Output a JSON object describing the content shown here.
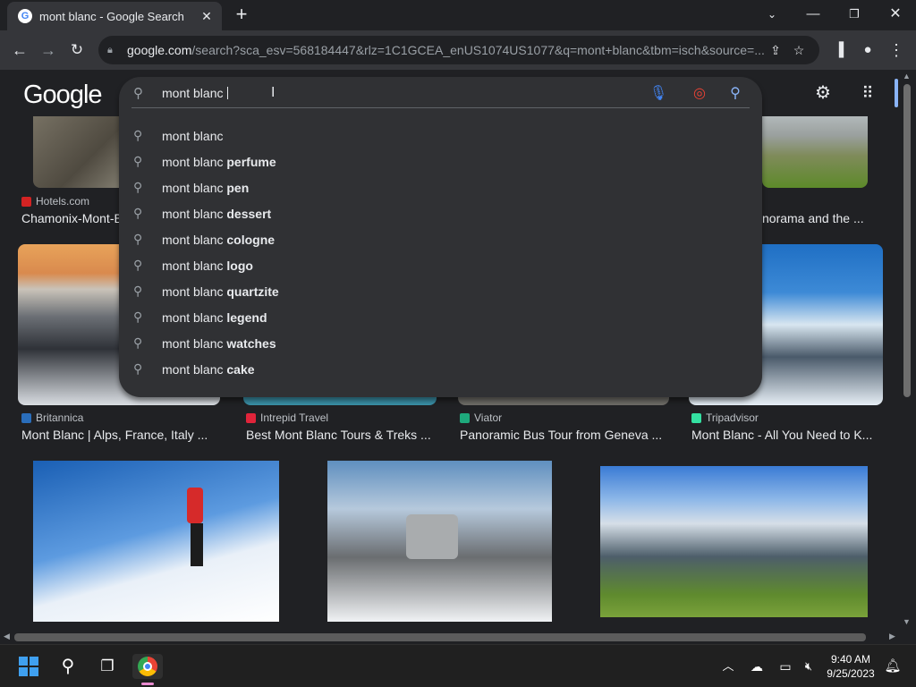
{
  "browser": {
    "tab_title": "mont blanc - Google Search",
    "tab_favicon": "G",
    "url_domain": "google.com",
    "url_path": "/search?sca_esv=568184447&rlz=1C1GCEA_enUS1074US1077&q=mont+blanc&tbm=isch&source=..."
  },
  "google": {
    "logo": "Google",
    "query": "mont blanc "
  },
  "suggestions": [
    {
      "base": "mont blanc",
      "bold": ""
    },
    {
      "base": "mont blanc ",
      "bold": "perfume"
    },
    {
      "base": "mont blanc ",
      "bold": "pen"
    },
    {
      "base": "mont blanc ",
      "bold": "dessert"
    },
    {
      "base": "mont blanc ",
      "bold": "cologne"
    },
    {
      "base": "mont blanc ",
      "bold": "logo"
    },
    {
      "base": "mont blanc ",
      "bold": "quartzite"
    },
    {
      "base": "mont blanc ",
      "bold": "legend"
    },
    {
      "base": "mont blanc ",
      "bold": "watches"
    },
    {
      "base": "mont blanc ",
      "bold": "cake"
    }
  ],
  "results": {
    "row1": [
      {
        "source": "Hotels.com",
        "caption": "Chamonix-Mont-B",
        "source_color": "#d32323"
      },
      {
        "source": "",
        "caption": "norama and the ...",
        "source_color": ""
      }
    ],
    "row2": [
      {
        "source": "Britannica",
        "caption": "Mont Blanc | Alps, France, Italy ...",
        "source_color": "#2a6ebb"
      },
      {
        "source": "Intrepid Travel",
        "caption": "Best Mont Blanc Tours & Treks ...",
        "source_color": "#e0243a"
      },
      {
        "source": "Viator",
        "caption": "Panoramic Bus Tour from Geneva ...",
        "source_color": "#1ea97c"
      },
      {
        "source": "Tripadvisor",
        "caption": "Mont Blanc - All You Need to K...",
        "source_color": "#34e0a1"
      }
    ]
  },
  "taskbar": {
    "time": "9:40 AM",
    "date": "9/25/2023"
  },
  "icons": {
    "search": "search-icon",
    "mic": "microphone-icon",
    "lens": "google-lens-icon",
    "settings": "gear-icon",
    "apps": "apps-grid-icon"
  }
}
